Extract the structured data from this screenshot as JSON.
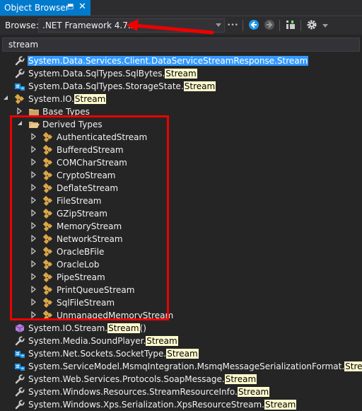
{
  "window": {
    "title": "Object Browser",
    "pin_glyph": "⬒",
    "close_glyph": "✕"
  },
  "toolbar": {
    "browse_label": "Browse:",
    "browse_value": ".NET Framework 4.7.2",
    "more_glyph": "•••",
    "icons": [
      "back-icon",
      "forward-icon",
      "add-reference-icon",
      "settings-icon"
    ]
  },
  "search": {
    "value": "stream",
    "placeholder": ""
  },
  "tree": {
    "top_items": [
      {
        "prefix": "System.Data.Services.Client.DataServiceStreamResponse.Stream",
        "match": "",
        "suffix": "",
        "icon": "property-wrench-icon",
        "selected": true
      },
      {
        "prefix": "System.Data.SqlTypes.SqlBytes.",
        "match": "Stream",
        "suffix": "",
        "icon": "property-wrench-icon",
        "selected": false
      },
      {
        "prefix": "System.Data.SqlTypes.StorageState.",
        "match": "Stream",
        "suffix": "",
        "icon": "enum-icon",
        "selected": false
      }
    ],
    "stream_class": {
      "prefix": "System.IO.",
      "match": "Stream",
      "suffix": ""
    },
    "base_types_label": "Base Types",
    "derived_types_label": "Derived Types",
    "derived": [
      "AuthenticatedStream",
      "BufferedStream",
      "COMCharStream",
      "CryptoStream",
      "DeflateStream",
      "FileStream",
      "GZipStream",
      "MemoryStream",
      "NetworkStream",
      "OracleBFile",
      "OracleLob",
      "PipeStream",
      "PrintQueueStream",
      "SqlFileStream",
      "UnmanagedMemoryStream"
    ],
    "bottom_items": [
      {
        "prefix": "System.IO.Stream.",
        "match": "Stream",
        "suffix": "()",
        "icon": "method-cube-icon"
      },
      {
        "prefix": "System.Media.SoundPlayer.",
        "match": "Stream",
        "suffix": "",
        "icon": "property-wrench-icon"
      },
      {
        "prefix": "System.Net.Sockets.SocketType.",
        "match": "Stream",
        "suffix": "",
        "icon": "enum-icon"
      },
      {
        "prefix": "System.ServiceModel.MsmqIntegration.MsmqMessageSerializationFormat.",
        "match": "Stream",
        "suffix": "",
        "icon": "enum-icon"
      },
      {
        "prefix": "System.Web.Services.Protocols.SoapMessage.",
        "match": "Stream",
        "suffix": "",
        "icon": "property-wrench-icon"
      },
      {
        "prefix": "System.Windows.Resources.StreamResourceInfo.",
        "match": "Stream",
        "suffix": "",
        "icon": "property-wrench-icon"
      },
      {
        "prefix": "System.Windows.Xps.Serialization.XpsResourceStream.",
        "match": "Stream",
        "suffix": "",
        "icon": "property-wrench-icon"
      }
    ]
  },
  "colors": {
    "accent": "#007acc",
    "selection": "#3399ff",
    "highlight": "#fffacd",
    "annotation": "#e00000",
    "class_icon": "#d9a648",
    "folder": "#dcb67a"
  }
}
